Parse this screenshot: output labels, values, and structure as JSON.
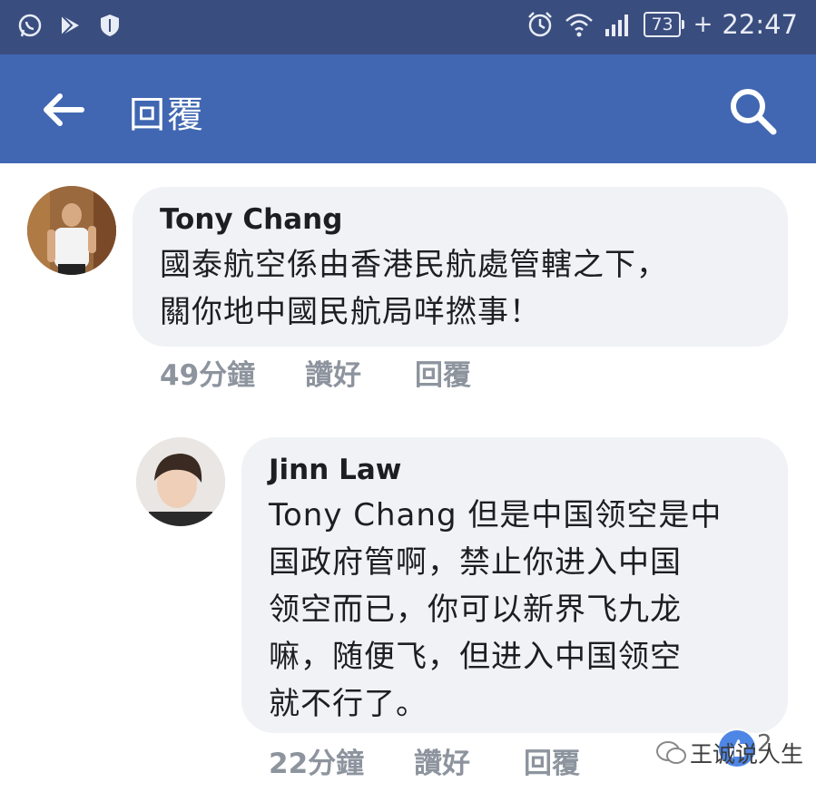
{
  "status_bar": {
    "icons_left": [
      "whatsapp-icon",
      "play-store-icon",
      "shield-icon"
    ],
    "icons_right": [
      "alarm-icon",
      "wifi-icon",
      "signal-icon"
    ],
    "battery": "73",
    "charging": "+",
    "time": "22:47"
  },
  "app_bar": {
    "title": "回覆"
  },
  "comments": [
    {
      "author": "Tony Chang",
      "text": "國泰航空係由香港民航處管轄之下，\n關你地中國民航局咩撚事！",
      "time": "49分鐘",
      "like": "讚好",
      "reply": "回覆"
    },
    {
      "author": "Jinn Law",
      "text": "Tony Chang 但是中国领空是中\n国政府管啊，禁止你进入中国\n领空而已，你可以新界飞九龙\n嘛，随便飞，但进入中国领空\n就不行了。",
      "time": "22分鐘",
      "like": "讚好",
      "reply": "回覆",
      "reaction_count": "2"
    }
  ],
  "watermark": "王诚说人生",
  "colors": {
    "status_bar": "#3a4d7f",
    "app_bar": "#4167b2",
    "bubble": "#f1f2f5",
    "meta_text": "#8d949e"
  }
}
